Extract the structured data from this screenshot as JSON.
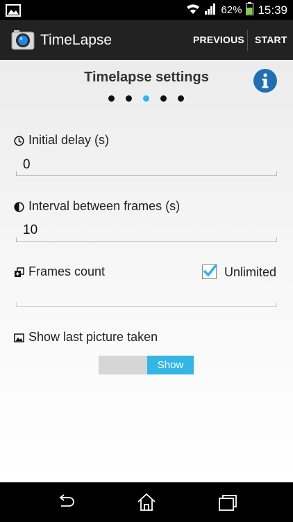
{
  "status_bar": {
    "battery": "62%",
    "time": "15:39"
  },
  "action_bar": {
    "title": "TimeLapse",
    "previous_label": "PREVIOUS",
    "start_label": "START"
  },
  "main": {
    "title": "Timelapse settings",
    "pager": {
      "count": 5,
      "active_index": 2
    },
    "fields": {
      "initial_delay": {
        "label": "Initial delay (s)",
        "value": "0"
      },
      "interval": {
        "label": "Interval between frames (s)",
        "value": "10"
      },
      "frames_count": {
        "label": "Frames count",
        "value": "",
        "unlimited_label": "Unlimited",
        "unlimited_checked": true
      }
    },
    "show_last_picture": {
      "label": "Show last picture taken",
      "toggle_label": "Show",
      "toggle_on": true
    }
  },
  "colors": {
    "accent": "#33b5e5",
    "action_bar": "#222222",
    "info_icon": "#1f6fb2"
  },
  "icons": {
    "status_left": "image-icon",
    "wifi": "wifi-icon",
    "signal": "signal-icon",
    "battery": "battery-icon",
    "app": "camera-icon",
    "info": "info-icon",
    "initial_delay": "clock-icon",
    "interval": "half-circle-icon",
    "frames_count": "frames-icon",
    "show_last_picture": "picture-icon",
    "nav_back": "back-icon",
    "nav_home": "home-icon",
    "nav_recents": "recents-icon"
  }
}
